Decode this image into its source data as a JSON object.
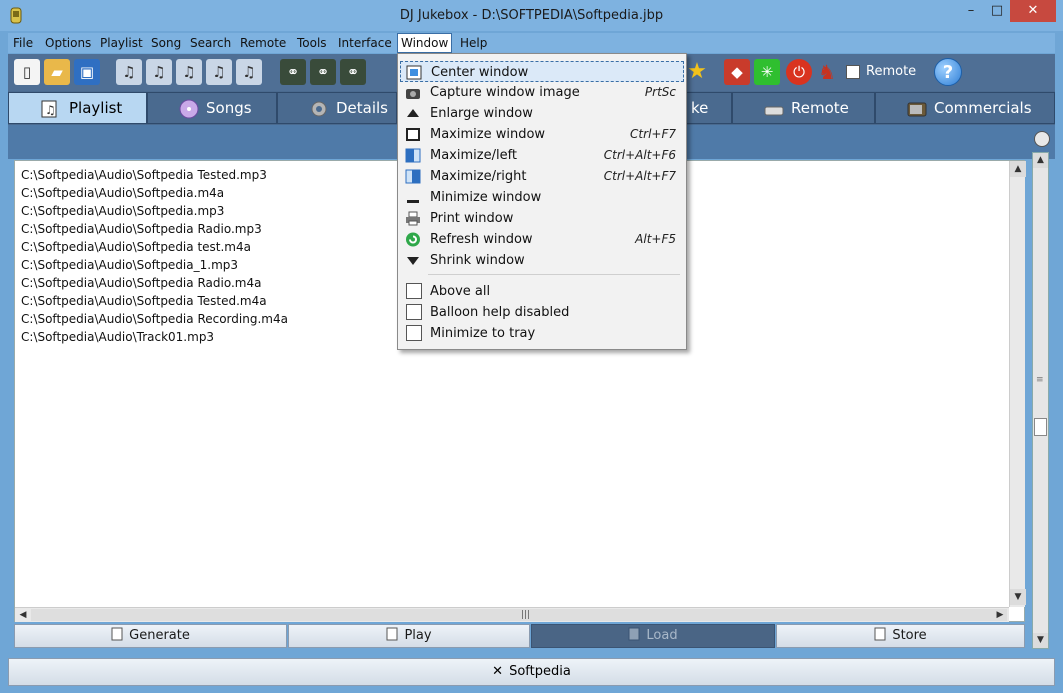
{
  "window": {
    "title": "DJ Jukebox - D:\\SOFTPEDIA\\Softpedia.jbp",
    "min": "–",
    "max": "□",
    "close": "✕"
  },
  "menubar": {
    "items": [
      {
        "id": "file",
        "label": "File"
      },
      {
        "id": "options",
        "label": "Options"
      },
      {
        "id": "playlist",
        "label": "Playlist"
      },
      {
        "id": "song",
        "label": "Song"
      },
      {
        "id": "search",
        "label": "Search"
      },
      {
        "id": "remote",
        "label": "Remote"
      },
      {
        "id": "tools",
        "label": "Tools"
      },
      {
        "id": "interface",
        "label": "Interface"
      },
      {
        "id": "window",
        "label": "Window"
      },
      {
        "id": "help",
        "label": "Help"
      }
    ]
  },
  "toolbar": {
    "remote_label": "Remote",
    "help_glyph": "?"
  },
  "tabs": [
    {
      "label": "Playlist",
      "icon": "music-note-icon"
    },
    {
      "label": "Songs",
      "icon": "cd-icon"
    },
    {
      "label": "Details",
      "icon": "gear-icon"
    },
    {
      "label": "ke",
      "icon": "karaoke-icon"
    },
    {
      "label": "Remote",
      "icon": "remote-icon"
    },
    {
      "label": "Commercials",
      "icon": "tv-icon"
    }
  ],
  "files": [
    "C:\\Softpedia\\Audio\\Softpedia Tested.mp3",
    "C:\\Softpedia\\Audio\\Softpedia.m4a",
    "C:\\Softpedia\\Audio\\Softpedia.mp3",
    "C:\\Softpedia\\Audio\\Softpedia Radio.mp3",
    "C:\\Softpedia\\Audio\\Softpedia test.m4a",
    "C:\\Softpedia\\Audio\\Softpedia_1.mp3",
    "C:\\Softpedia\\Audio\\Softpedia Radio.m4a",
    "C:\\Softpedia\\Audio\\Softpedia Tested.m4a",
    "C:\\Softpedia\\Audio\\Softpedia Recording.m4a",
    "C:\\Softpedia\\Audio\\Track01.mp3"
  ],
  "actions": {
    "generate": "Generate",
    "play": "Play",
    "load": "Load",
    "store": "Store"
  },
  "status": {
    "label": "Softpedia",
    "icon": "✕"
  },
  "window_menu": {
    "items": [
      {
        "label": "Center window",
        "accel": "",
        "icon": "center-window-icon"
      },
      {
        "label": "Capture window image",
        "accel": "PrtSc",
        "icon": "camera-icon"
      },
      {
        "label": "Enlarge window",
        "accel": "",
        "icon": "enlarge-icon"
      },
      {
        "label": "Maximize window",
        "accel": "Ctrl+F7",
        "icon": "maximize-icon"
      },
      {
        "label": "Maximize/left",
        "accel": "Ctrl+Alt+F6",
        "icon": "maximize-left-icon"
      },
      {
        "label": "Maximize/right",
        "accel": "Ctrl+Alt+F7",
        "icon": "maximize-right-icon"
      },
      {
        "label": "Minimize window",
        "accel": "",
        "icon": "minimize-icon"
      },
      {
        "label": "Print window",
        "accel": "",
        "icon": "printer-icon"
      },
      {
        "label": "Refresh window",
        "accel": "Alt+F5",
        "icon": "refresh-icon"
      },
      {
        "label": "Shrink window",
        "accel": "",
        "icon": "shrink-icon"
      }
    ],
    "checks": [
      {
        "label": "Above all",
        "checked": false
      },
      {
        "label": "Balloon help disabled",
        "checked": false
      },
      {
        "label": "Minimize to tray",
        "checked": false
      }
    ]
  }
}
